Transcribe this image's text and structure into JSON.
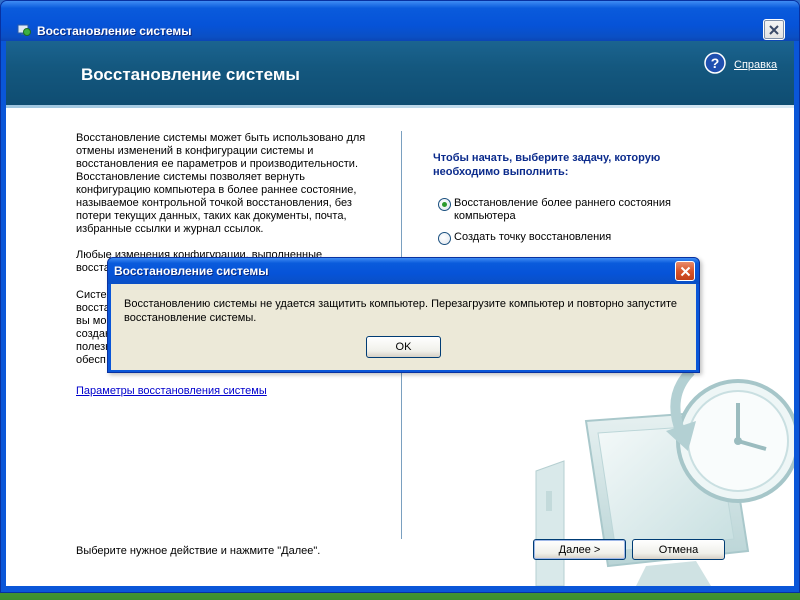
{
  "main_window": {
    "title": "Восстановление системы",
    "page_title": "Восстановление системы",
    "help_label": "Справка"
  },
  "left_pane": {
    "intro_lines": [
      "Восстановление системы может быть использовано для",
      "отмены изменений в конфигурации системы и",
      "восстановления ее параметров и производительности.",
      "Восстановление системы позволяет вернуть",
      "конфигурацию компьютера в более раннее состояние,",
      "называемое контрольной точкой восстановления, без",
      "потери текущих данных, таких как документы, почта,",
      "избранные ссылки и журнал ссылок."
    ],
    "para2_lines": [
      "Любые изменения конфигурации, выполненные",
      "восста"
    ],
    "para3_lines": [
      "Систе",
      "восста",
      "вы мо",
      "создан",
      "полезн",
      "обесп"
    ],
    "settings_link": "Параметры восстановления системы",
    "bottom_hint": "Выберите нужное действие и нажмите \"Далее\"."
  },
  "right_pane": {
    "task_prompt": "Чтобы начать, выберите задачу, которую необходимо выполнить:",
    "options": [
      {
        "label": "Восстановление более раннего состояния компьютера",
        "selected": true
      },
      {
        "label": "Создать точку восстановления",
        "selected": false
      }
    ]
  },
  "buttons": {
    "next_label_underlined": "Д",
    "next_label_rest": "алее >",
    "cancel_label": "Отмена"
  },
  "dialog": {
    "title": "Восстановление системы",
    "message": "Восстановлению системы не удается защитить компьютер. Перезагрузите компьютер и повторно запустите восстановление системы.",
    "ok_label": "OK"
  },
  "colors": {
    "titlebar_blue": "#0a56d8",
    "header_band": "#14587f",
    "prompt_blue": "#0b2b8c",
    "link_blue": "#0000cc",
    "dialog_face": "#ece9d8",
    "close_red": "#d8542a"
  }
}
